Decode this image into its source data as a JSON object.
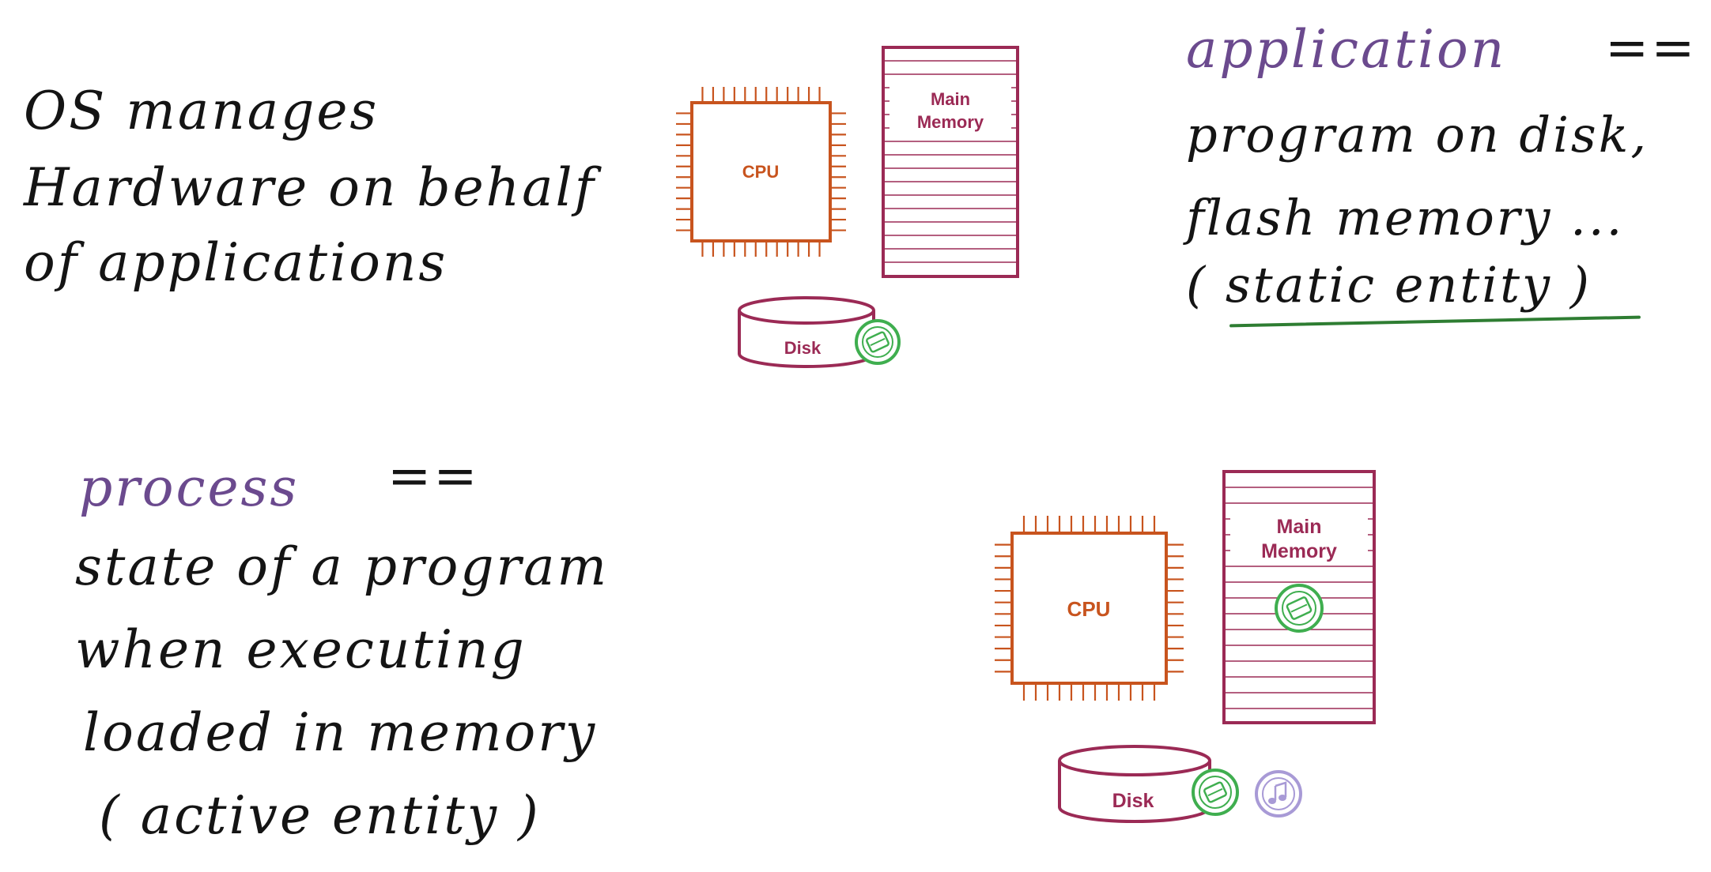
{
  "notes": {
    "os_manages": [
      "OS manages",
      "Hardware on behalf",
      "of applications"
    ],
    "application_word": "application",
    "application_eq": "==",
    "application_def": [
      "program on disk,",
      "flash memory ...",
      "( static entity )"
    ],
    "process_word": "process",
    "process_eq": "==",
    "process_def": [
      "state of a program",
      "when executing",
      "loaded in memory",
      "( active entity )"
    ]
  },
  "diagram_top": {
    "cpu": "CPU",
    "memory": [
      "Main",
      "Memory"
    ],
    "disk": "Disk"
  },
  "diagram_bottom": {
    "cpu": "CPU",
    "memory": [
      "Main",
      "Memory"
    ],
    "disk": "Disk"
  },
  "colors": {
    "cpu": "#c8541e",
    "memory": "#9b2a55",
    "disk": "#9b2a55",
    "app_icon": "#3fae4f",
    "music_icon": "#a89ad6",
    "ink": "#141414",
    "purple_ink": "#6b4a8e",
    "underline": "#2e7d32"
  },
  "icons": [
    "application-icon",
    "music-note-icon"
  ]
}
